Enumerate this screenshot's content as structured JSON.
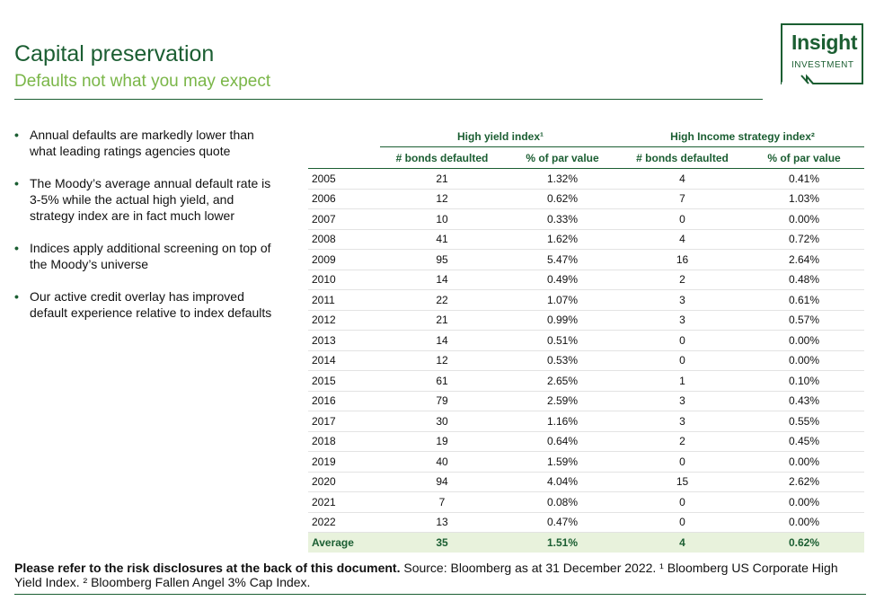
{
  "header": {
    "title": "Capital preservation",
    "subtitle": "Defaults not what you may expect"
  },
  "logo": {
    "word1": "Insight",
    "word2": "INVESTMENT",
    "color": "#1b5e32"
  },
  "bullets": [
    "Annual defaults are markedly lower than what leading ratings agencies quote",
    "The Moody’s average annual default rate is 3-5% while the actual high yield, and strategy index are in fact much lower",
    "Indices apply additional screening on top of the Moody’s universe",
    "Our active credit overlay has improved default experience relative to index defaults"
  ],
  "table": {
    "group_headers": [
      "High yield index¹",
      "High Income strategy index²"
    ],
    "columns": [
      "# bonds defaulted",
      "% of par value",
      "# bonds defaulted",
      "% of par value"
    ],
    "rows": [
      [
        "2005",
        "21",
        "1.32%",
        "4",
        "0.41%"
      ],
      [
        "2006",
        "12",
        "0.62%",
        "7",
        "1.03%"
      ],
      [
        "2007",
        "10",
        "0.33%",
        "0",
        "0.00%"
      ],
      [
        "2008",
        "41",
        "1.62%",
        "4",
        "0.72%"
      ],
      [
        "2009",
        "95",
        "5.47%",
        "16",
        "2.64%"
      ],
      [
        "2010",
        "14",
        "0.49%",
        "2",
        "0.48%"
      ],
      [
        "2011",
        "22",
        "1.07%",
        "3",
        "0.61%"
      ],
      [
        "2012",
        "21",
        "0.99%",
        "3",
        "0.57%"
      ],
      [
        "2013",
        "14",
        "0.51%",
        "0",
        "0.00%"
      ],
      [
        "2014",
        "12",
        "0.53%",
        "0",
        "0.00%"
      ],
      [
        "2015",
        "61",
        "2.65%",
        "1",
        "0.10%"
      ],
      [
        "2016",
        "79",
        "2.59%",
        "3",
        "0.43%"
      ],
      [
        "2017",
        "30",
        "1.16%",
        "3",
        "0.55%"
      ],
      [
        "2018",
        "19",
        "0.64%",
        "2",
        "0.45%"
      ],
      [
        "2019",
        "40",
        "1.59%",
        "0",
        "0.00%"
      ],
      [
        "2020",
        "94",
        "4.04%",
        "15",
        "2.62%"
      ],
      [
        "2021",
        "7",
        "0.08%",
        "0",
        "0.00%"
      ],
      [
        "2022",
        "13",
        "0.47%",
        "0",
        "0.00%"
      ]
    ],
    "average": [
      "Average",
      "35",
      "1.51%",
      "4",
      "0.62%"
    ]
  },
  "footnote": {
    "bold": "Please refer to the risk disclosures at the back of this document.",
    "text": " Source: Bloomberg as at 31 December 2022. ¹ Bloomberg US Corporate High Yield Index. ² Bloomberg Fallen Angel 3% Cap Index."
  },
  "colors": {
    "dark_green": "#1b5e32",
    "light_green": "#7ab648",
    "average_row_bg": "#e8f2dc"
  }
}
